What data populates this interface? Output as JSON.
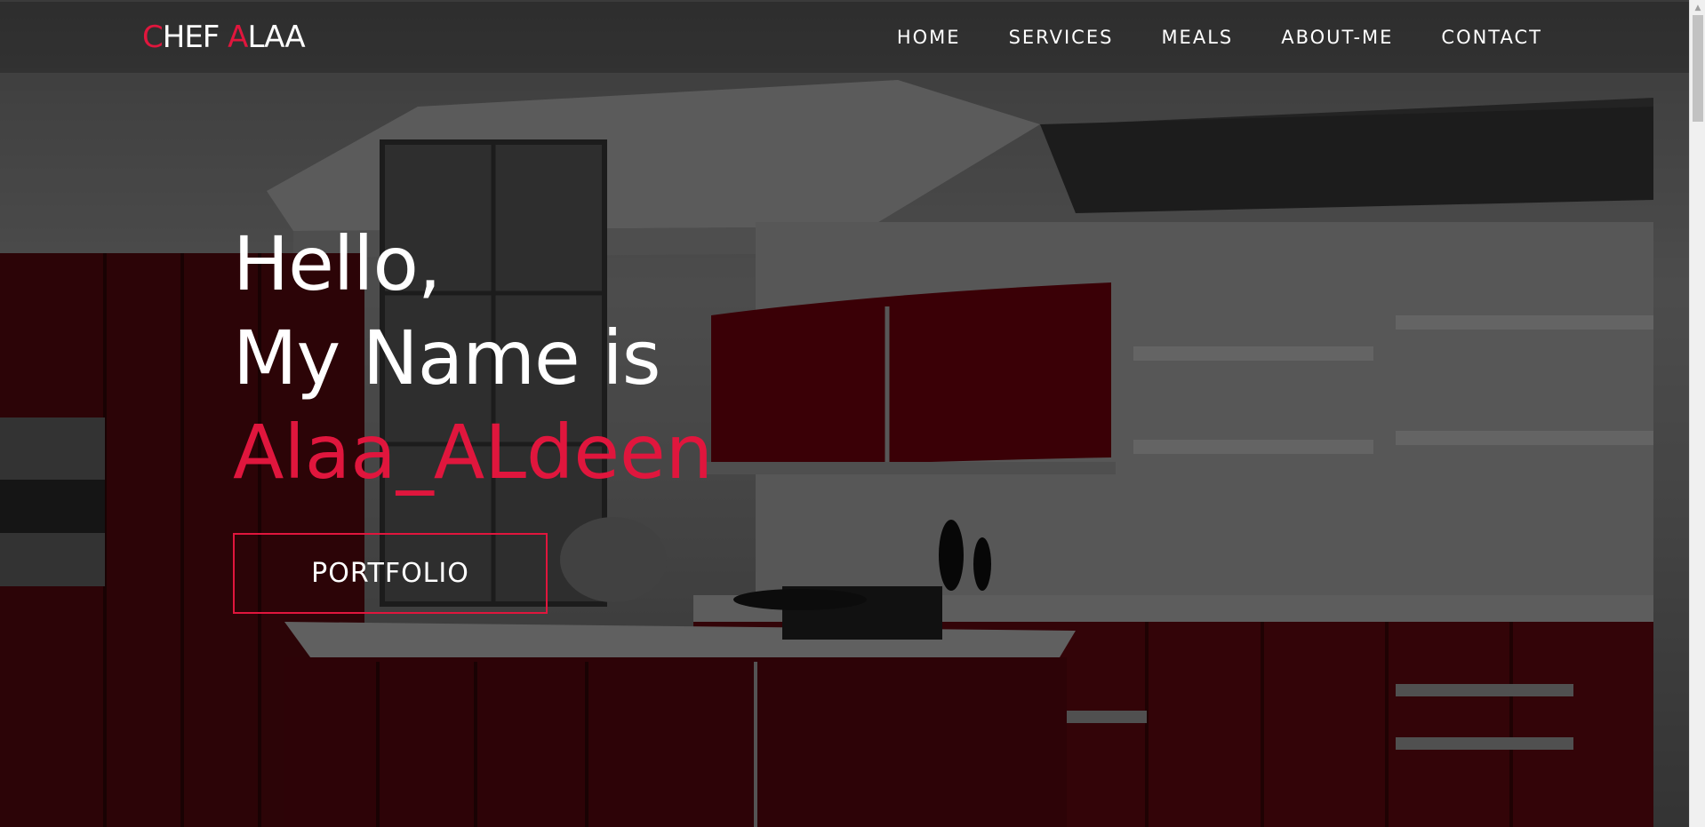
{
  "brand": {
    "logo_c": "C",
    "logo_hef": "HEF ",
    "logo_a": "A",
    "logo_laa": "LAA",
    "accent_color": "#e0163d"
  },
  "nav": {
    "items": [
      "HOME",
      "SERVICES",
      "MEALS",
      "ABOUT-ME",
      "CONTACT"
    ]
  },
  "hero": {
    "line1": "Hello,",
    "line2": "My Name is",
    "name": "Alaa_ALdeen",
    "button_label": "PORTFOLIO"
  },
  "icons": {
    "scroll_up": "scroll-up-arrow-icon"
  }
}
